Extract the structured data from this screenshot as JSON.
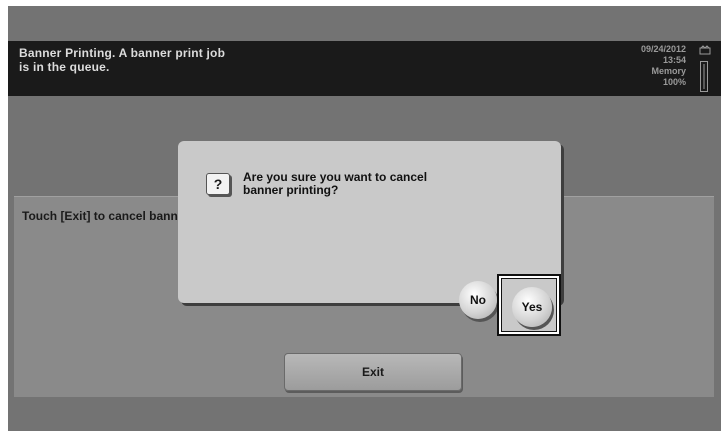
{
  "header": {
    "message": "Banner Printing. A banner print job\nis in the queue.",
    "date": "09/24/2012",
    "time": "13:54",
    "memory_label": "Memory",
    "memory_value": "100%",
    "memory_level_percent": 100
  },
  "main": {
    "instruction": "Touch [Exit] to cancel bann",
    "exit_label": "Exit"
  },
  "dialog": {
    "question": "Are you sure you want to cancel\nbanner printing?",
    "icon_glyph": "?",
    "no_label": "No",
    "yes_label": "Yes"
  }
}
